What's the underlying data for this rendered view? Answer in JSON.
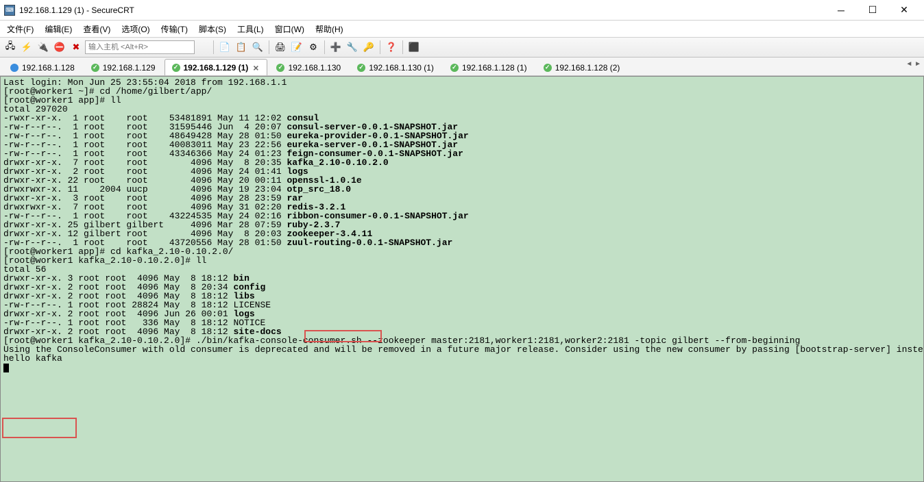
{
  "title": "192.168.1.129 (1) - SecureCRT",
  "menu": {
    "file": "文件(F)",
    "edit": "编辑(E)",
    "view": "查看(V)",
    "options": "选项(O)",
    "transfer": "传输(T)",
    "script": "脚本(S)",
    "tools": "工具(L)",
    "window": "窗口(W)",
    "help": "帮助(H)"
  },
  "host_placeholder": "输入主机 <Alt+R>",
  "tabs": [
    {
      "label": "192.168.1.128",
      "status": "blue",
      "active": false
    },
    {
      "label": "192.168.1.129",
      "status": "green",
      "active": false
    },
    {
      "label": "192.168.1.129 (1)",
      "status": "green",
      "active": true
    },
    {
      "label": "192.168.1.130",
      "status": "green",
      "active": false
    },
    {
      "label": "192.168.1.130 (1)",
      "status": "green",
      "active": false
    },
    {
      "label": "192.168.1.128 (1)",
      "status": "green",
      "active": false
    },
    {
      "label": "192.168.1.128 (2)",
      "status": "green",
      "active": false
    }
  ],
  "terminal": {
    "line0": "Last login: Mon Jun 25 23:55:04 2018 from 192.168.1.1",
    "line1": "[root@worker1 ~]# cd /home/gilbert/app/",
    "line2": "[root@worker1 app]# ll",
    "line3": "total 297020",
    "line4": "-rwxr-xr-x.  1 root    root    53481891 May 11 12:02 ",
    "f4": "consul",
    "line5": "-rw-r--r--.  1 root    root    31595446 Jun  4 20:07 ",
    "f5": "consul-server-0.0.1-SNAPSHOT.jar",
    "line6": "-rw-r--r--.  1 root    root    48649428 May 28 01:50 ",
    "f6": "eureka-provider-0.0.1-SNAPSHOT.jar",
    "line7": "-rw-r--r--.  1 root    root    40083011 May 23 22:56 ",
    "f7": "eureka-server-0.0.1-SNAPSHOT.jar",
    "line8": "-rw-r--r--.  1 root    root    43346366 May 24 01:23 ",
    "f8": "feign-consumer-0.0.1-SNAPSHOT.jar",
    "line9": "drwxr-xr-x.  7 root    root        4096 May  8 20:35 ",
    "f9": "kafka_2.10-0.10.2.0",
    "line10": "drwxr-xr-x.  2 root    root        4096 May 24 01:41 ",
    "f10": "logs",
    "line11": "drwxr-xr-x. 22 root    root        4096 May 20 00:11 ",
    "f11": "openssl-1.0.1e",
    "line12": "drwxrwxr-x. 11    2004 uucp        4096 May 19 23:04 ",
    "f12": "otp_src_18.0",
    "line13": "drwxr-xr-x.  3 root    root        4096 May 28 23:59 ",
    "f13": "rar",
    "line14": "drwxrwxr-x.  7 root    root        4096 May 31 02:20 ",
    "f14": "redis-3.2.1",
    "line15": "-rw-r--r--.  1 root    root    43224535 May 24 02:16 ",
    "f15": "ribbon-consumer-0.0.1-SNAPSHOT.jar",
    "line16": "drwxr-xr-x. 25 gilbert gilbert     4096 Mar 28 07:59 ",
    "f16": "ruby-2.3.7",
    "line17": "drwxr-xr-x. 12 gilbert root        4096 May  8 20:03 ",
    "f17": "zookeeper-3.4.11",
    "line18": "-rw-r--r--.  1 root    root    43720556 May 28 01:50 ",
    "f18": "zuul-routing-0.0.1-SNAPSHOT.jar",
    "line19": "[root@worker1 app]# cd kafka_2.10-0.10.2.0/",
    "line20": "[root@worker1 kafka_2.10-0.10.2.0]# ll",
    "line21": "total 56",
    "line22": "drwxr-xr-x. 3 root root  4096 May  8 18:12 ",
    "f22": "bin",
    "line23": "drwxr-xr-x. 2 root root  4096 May  8 20:34 ",
    "f23": "config",
    "line24": "drwxr-xr-x. 2 root root  4096 May  8 18:12 ",
    "f24": "libs",
    "line25": "-rw-r--r--. 1 root root 28824 May  8 18:12 LICENSE",
    "line26": "drwxr-xr-x. 2 root root  4096 Jun 26 00:01 ",
    "f26": "logs",
    "line27": "-rw-r--r--. 1 root root   336 May  8 18:12 NOTICE",
    "line28": "drwxr-xr-x. 2 root root  4096 May  8 18:12 ",
    "f28": "site-docs",
    "line29": "[root@worker1 kafka_2.10-0.10.2.0]# ./bin/kafka-console-consumer.sh --zookeeper master:2181,worker1:2181,worker2:2181 -topic gilbert --from-beginning",
    "line30": "Using the ConsoleConsumer with old consumer is deprecated and will be removed in a future major release. Consider using the new consumer by passing [bootstrap-server] instead of [zookeeper].",
    "line31": "hello kafka"
  }
}
